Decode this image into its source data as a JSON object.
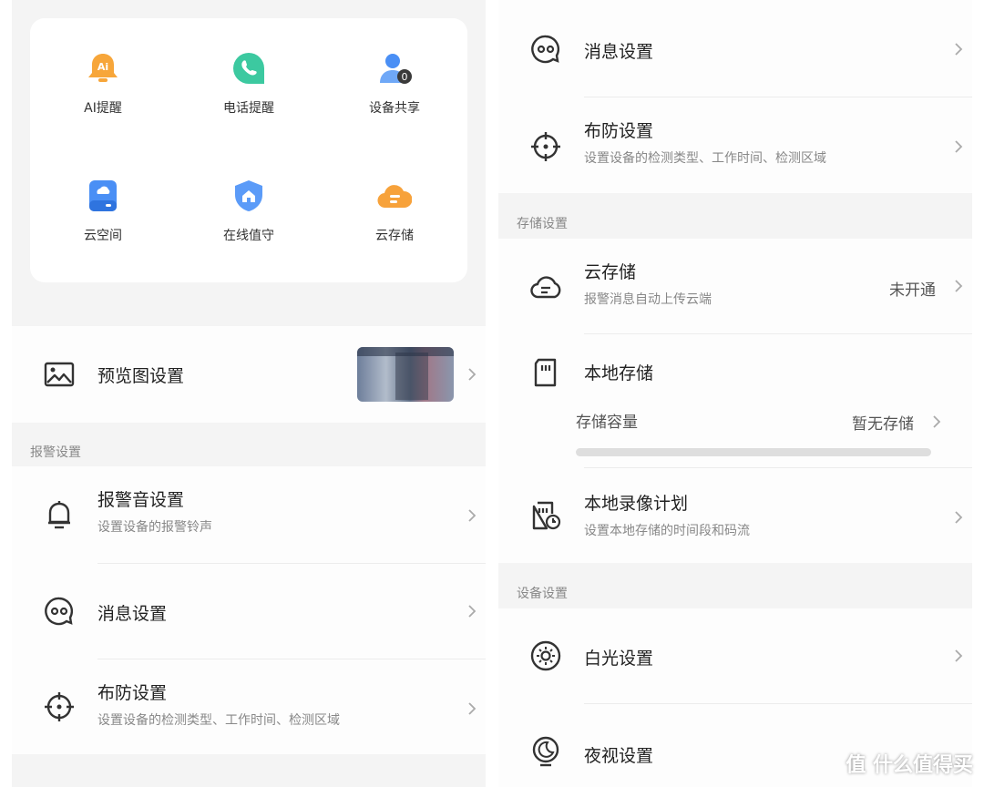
{
  "quick_actions": [
    {
      "label": "AI提醒",
      "icon": "ai-bell-icon"
    },
    {
      "label": "电话提醒",
      "icon": "phone-chat-icon"
    },
    {
      "label": "设备共享",
      "icon": "share-user-icon",
      "badge": "0"
    },
    {
      "label": "云空间",
      "icon": "cloud-drive-icon"
    },
    {
      "label": "在线值守",
      "icon": "shield-home-icon"
    },
    {
      "label": "云存储",
      "icon": "cloud-storage-icon"
    }
  ],
  "left": {
    "preview": {
      "title": "预览图设置",
      "icon": "image-icon"
    },
    "alarm_section": "报警设置",
    "alarm_sound": {
      "title": "报警音设置",
      "subtitle": "设置设备的报警铃声",
      "icon": "bell-icon"
    },
    "message": {
      "title": "消息设置",
      "icon": "message-icon"
    },
    "defense": {
      "title": "布防设置",
      "subtitle": "设置设备的检测类型、工作时间、检测区域",
      "icon": "crosshair-icon"
    }
  },
  "right": {
    "message": {
      "title": "消息设置",
      "icon": "message-icon"
    },
    "defense": {
      "title": "布防设置",
      "subtitle": "设置设备的检测类型、工作时间、检测区域",
      "icon": "crosshair-icon"
    },
    "storage_section": "存储设置",
    "cloud": {
      "title": "云存储",
      "subtitle": "报警消息自动上传云端",
      "value": "未开通",
      "icon": "cloud-icon"
    },
    "local": {
      "title": "本地存储",
      "icon": "sd-card-icon"
    },
    "capacity": {
      "label": "存储容量",
      "value": "暂无存储",
      "progress": 0
    },
    "record_plan": {
      "title": "本地录像计划",
      "subtitle": "设置本地存储的时间段和码流",
      "icon": "sd-clock-icon"
    },
    "device_section": "设备设置",
    "white_light": {
      "title": "白光设置",
      "icon": "sun-icon"
    },
    "night_vision": {
      "title": "夜视设置",
      "icon": "moon-icon"
    }
  },
  "watermark": "值 什么值得买",
  "colors": {
    "ai": "#f5a623",
    "phone": "#3cc9a0",
    "share": "#4a8ff5",
    "cloud_drive": "#4a8ff5",
    "shield": "#5b9bf8",
    "cloud_store": "#f7a23b"
  }
}
